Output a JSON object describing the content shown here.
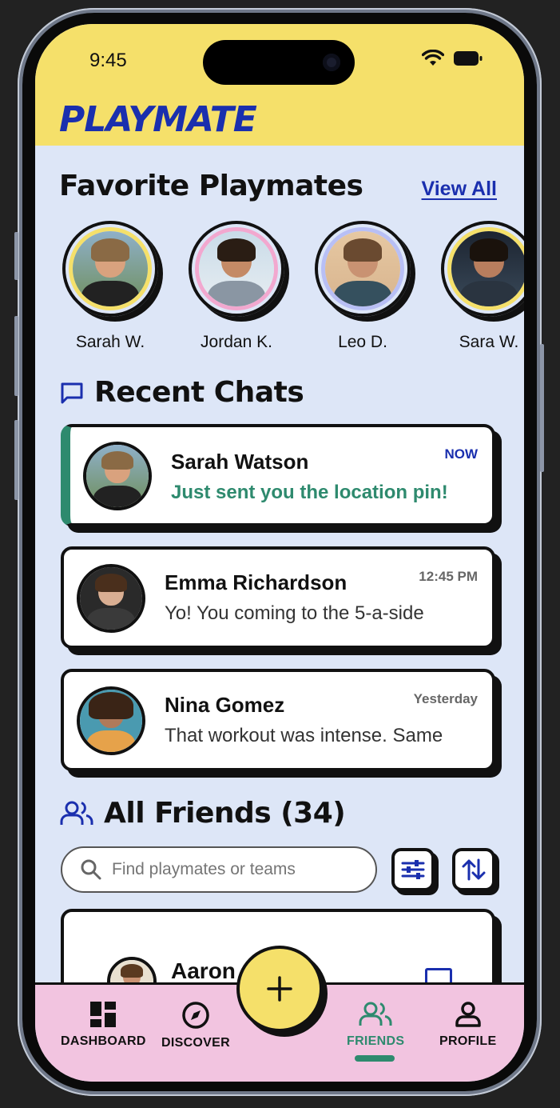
{
  "status_bar": {
    "time": "9:45"
  },
  "app": {
    "brand": "PLAYMATE"
  },
  "favorites": {
    "title": "Favorite Playmates",
    "view_all": "View All",
    "items": [
      {
        "name": "Sarah W.",
        "ring_color": "#f5e06a"
      },
      {
        "name": "Jordan K.",
        "ring_color": "#f2a8cf"
      },
      {
        "name": "Leo D.",
        "ring_color": "#b8bff5"
      },
      {
        "name": "Sara W.",
        "ring_color": "#f5e06a"
      }
    ]
  },
  "recent_chats": {
    "title": "Recent Chats",
    "items": [
      {
        "name": "Sarah Watson",
        "message": "Just sent you the location pin!",
        "time": "NOW",
        "active": true
      },
      {
        "name": "Emma Richardson",
        "message": "Yo! You coming to the 5-a-side",
        "time": "12:45 PM",
        "active": false
      },
      {
        "name": "Nina Gomez",
        "message": "That workout was intense. Same",
        "time": "Yesterday",
        "active": false
      }
    ]
  },
  "friends": {
    "title": "All Friends (34)",
    "search_placeholder": "Find playmates or teams",
    "items": [
      {
        "name": "Aaron"
      }
    ]
  },
  "nav": {
    "items": [
      {
        "label": "DASHBOARD",
        "icon": "dashboard-icon"
      },
      {
        "label": "DISCOVER",
        "icon": "compass-icon"
      },
      {
        "label": "FRIENDS",
        "icon": "friends-icon",
        "active": true
      },
      {
        "label": "PROFILE",
        "icon": "profile-icon"
      }
    ],
    "fab_icon": "plus-icon"
  },
  "colors": {
    "header": "#f5e06a",
    "background": "#dde6f7",
    "brand_blue": "#1a2fae",
    "accent_green": "#2e8a6e",
    "nav_pink": "#f2c4e0"
  }
}
